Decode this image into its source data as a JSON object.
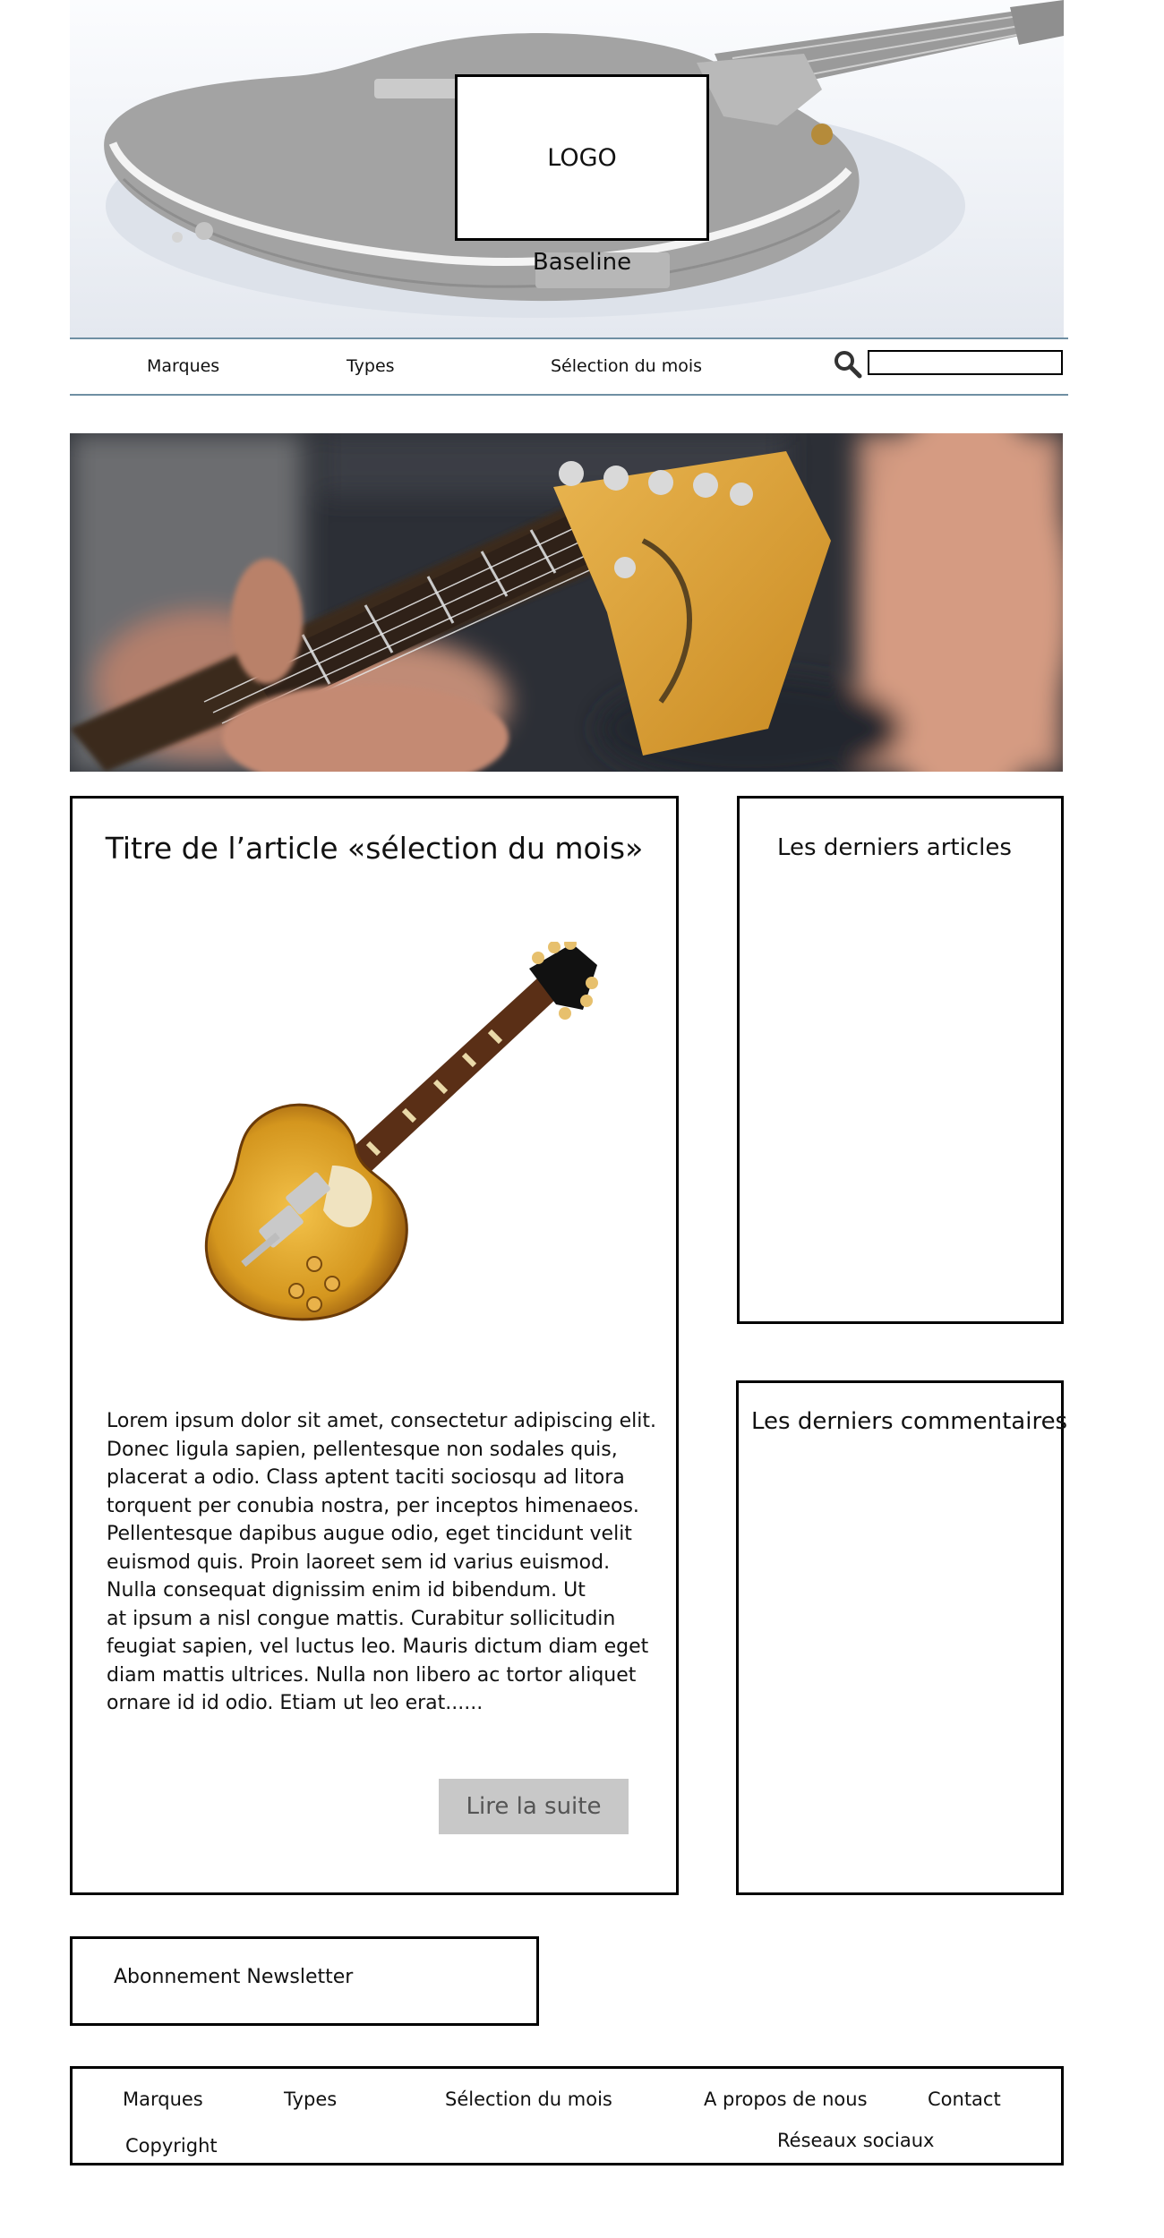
{
  "header": {
    "logo_text": "LOGO",
    "baseline": "Baseline"
  },
  "nav": {
    "items": [
      {
        "label": "Marques"
      },
      {
        "label": "Types"
      },
      {
        "label": "Sélection du mois"
      }
    ],
    "search_icon": "search-icon",
    "search_value": ""
  },
  "hero": {
    "image": "guitar-headstock-closeup"
  },
  "article": {
    "title": "Titre de l’article «sélection du mois»",
    "image": "les-paul-guitar",
    "body_lines": [
      "Lorem ipsum dolor sit amet, consectetur adipiscing elit.",
      "Donec ligula sapien, pellentesque non sodales quis,",
      "placerat a odio. Class aptent taciti sociosqu ad litora",
      "torquent per conubia nostra, per inceptos himenaeos.",
      "Pellentesque dapibus augue odio, eget tincidunt velit",
      "euismod quis. Proin laoreet sem id varius euismod.",
      "Nulla consequat dignissim enim id bibendum. Ut",
      "at ipsum a nisl congue mattis. Curabitur sollicitudin",
      "feugiat sapien, vel luctus leo. Mauris dictum diam eget",
      "diam mattis ultrices. Nulla non libero ac tortor aliquet",
      "ornare id id odio. Etiam ut leo erat......"
    ],
    "read_more_label": "Lire la suite"
  },
  "sidebar": {
    "latest_articles_title": "Les derniers articles",
    "latest_comments_title": "Les derniers commentaires"
  },
  "newsletter": {
    "label": "Abonnement Newsletter"
  },
  "footer": {
    "links": [
      {
        "label": "Marques"
      },
      {
        "label": "Types"
      },
      {
        "label": "Sélection du mois"
      },
      {
        "label": "A propos de nous"
      },
      {
        "label": "Contact"
      }
    ],
    "copyright": "Copyright",
    "social": "Réseaux sociaux"
  },
  "colors": {
    "nav_line": "#6f8fa3",
    "read_more_bg": "#c8c8c8",
    "guitar_body": "#d4961e"
  }
}
